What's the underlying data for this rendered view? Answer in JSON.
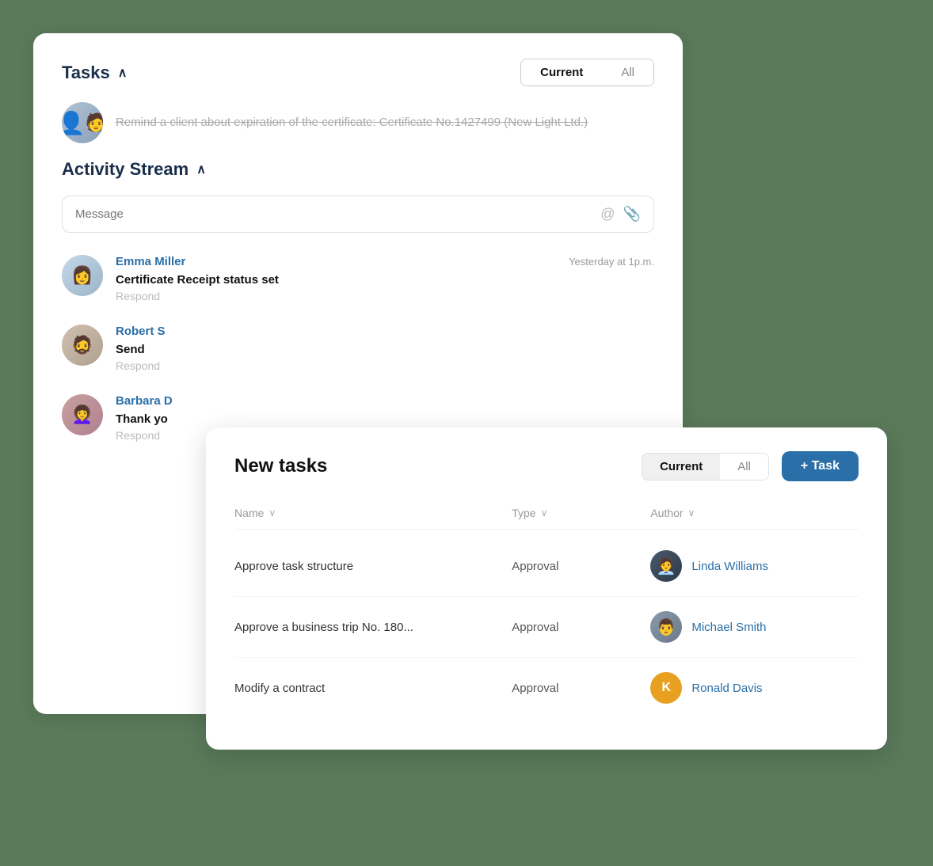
{
  "main_card": {
    "tasks_title": "Tasks",
    "toggle_current": "Current",
    "toggle_all": "All",
    "task_text": "Remind a client about expiration of the certificate: Certificate No.1427499 (New Light Ltd.)",
    "activity_stream_title": "Activity Stream",
    "message_placeholder": "Message",
    "activities": [
      {
        "name": "Emma Miller",
        "time": "Yesterday at 1p.m.",
        "title": "Certificate Receipt status set",
        "action": "Respond",
        "avatar_type": "emma"
      },
      {
        "name": "Robert S",
        "time": "",
        "title": "Send",
        "action": "Respond",
        "avatar_type": "robert"
      },
      {
        "name": "Barbara D",
        "time": "",
        "title": "Thank yo",
        "action": "Respond",
        "avatar_type": "barbara"
      }
    ]
  },
  "overlay_card": {
    "title": "New tasks",
    "toggle_current": "Current",
    "toggle_all": "All",
    "add_task_label": "+ Task",
    "columns": {
      "name": "Name",
      "type": "Type",
      "author": "Author"
    },
    "rows": [
      {
        "name": "Approve task structure",
        "type": "Approval",
        "author": "Linda  Williams",
        "avatar_type": "linda",
        "avatar_letter": ""
      },
      {
        "name": "Approve a business trip No. 180...",
        "type": "Approval",
        "author": "Michael Smith",
        "avatar_type": "michael",
        "avatar_letter": ""
      },
      {
        "name": "Modify a contract",
        "type": "Approval",
        "author": "Ronald Davis",
        "avatar_type": "ronald",
        "avatar_letter": "K"
      }
    ]
  }
}
